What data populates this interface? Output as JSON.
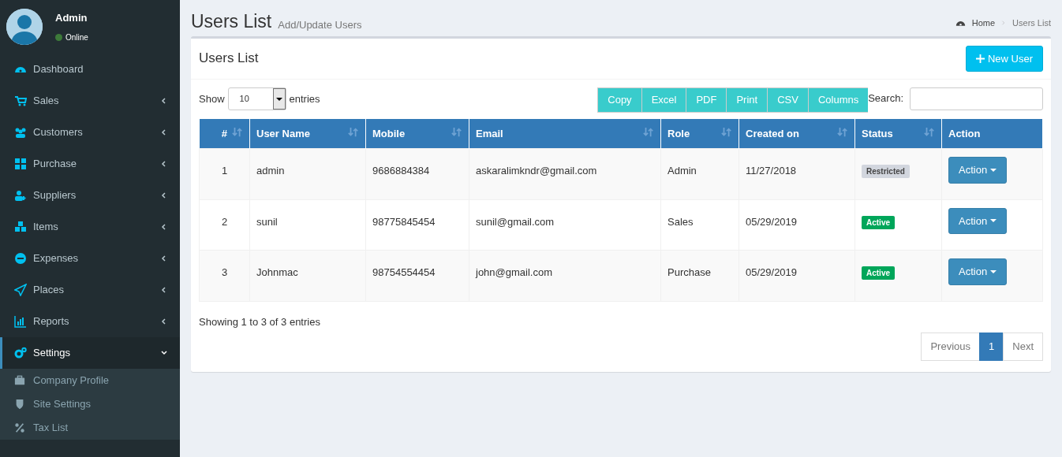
{
  "user_panel": {
    "name": "Admin",
    "status": "Online"
  },
  "sidebar": {
    "items": [
      {
        "label": "Dashboard",
        "kind": "link",
        "selected": false
      },
      {
        "label": "Sales",
        "kind": "tree",
        "selected": false,
        "expanded": false
      },
      {
        "label": "Customers",
        "kind": "tree",
        "selected": false,
        "expanded": false
      },
      {
        "label": "Purchase",
        "kind": "tree",
        "selected": false,
        "expanded": false
      },
      {
        "label": "Suppliers",
        "kind": "tree",
        "selected": false,
        "expanded": false
      },
      {
        "label": "Items",
        "kind": "tree",
        "selected": false,
        "expanded": false
      },
      {
        "label": "Expenses",
        "kind": "tree",
        "selected": false,
        "expanded": false
      },
      {
        "label": "Places",
        "kind": "tree",
        "selected": false,
        "expanded": false
      },
      {
        "label": "Reports",
        "kind": "tree",
        "selected": false,
        "expanded": false
      },
      {
        "label": "Settings",
        "kind": "tree",
        "selected": true,
        "expanded": true,
        "children": [
          {
            "label": "Company Profile"
          },
          {
            "label": "Site Settings"
          },
          {
            "label": "Tax List"
          }
        ]
      }
    ]
  },
  "page_header": {
    "title": "Users List",
    "subtitle": "Add/Update Users"
  },
  "breadcrumb": [
    "Home",
    "Users List"
  ],
  "box": {
    "title": "Users List",
    "new_button": "New User"
  },
  "length": {
    "show": "Show",
    "value": "10",
    "entries": "entries"
  },
  "export_buttons": [
    "Copy",
    "Excel",
    "PDF",
    "Print",
    "CSV",
    "Columns"
  ],
  "search": {
    "label": "Search:"
  },
  "table": {
    "columns": [
      {
        "label": "#",
        "sortable": true
      },
      {
        "label": "User Name",
        "sortable": true
      },
      {
        "label": "Mobile",
        "sortable": true
      },
      {
        "label": "Email",
        "sortable": true
      },
      {
        "label": "Role",
        "sortable": true
      },
      {
        "label": "Created on",
        "sortable": true
      },
      {
        "label": "Status",
        "sortable": true
      },
      {
        "label": "Action",
        "sortable": false
      }
    ],
    "rows": [
      {
        "cells": [
          "1",
          "admin",
          "9686884384",
          "askaralimkndr@gmail.com",
          "Admin",
          "11/27/2018"
        ],
        "status": {
          "label": "Restricted",
          "kind": "restricted"
        },
        "action": "Action"
      },
      {
        "cells": [
          "2",
          "sunil",
          "98775845454",
          "sunil@gmail.com",
          "Sales",
          "05/29/2019"
        ],
        "status": {
          "label": "Active",
          "kind": "active"
        },
        "action": "Action"
      },
      {
        "cells": [
          "3",
          "Johnmac",
          "98754554454",
          "john@gmail.com",
          "Purchase",
          "05/29/2019"
        ],
        "status": {
          "label": "Active",
          "kind": "active"
        },
        "action": "Action"
      }
    ]
  },
  "info": "Showing 1 to 3 of 3 entries",
  "pagination": [
    {
      "label": "Previous",
      "selected": false
    },
    {
      "label": "1",
      "selected": true
    },
    {
      "label": "Next",
      "selected": false
    }
  ]
}
